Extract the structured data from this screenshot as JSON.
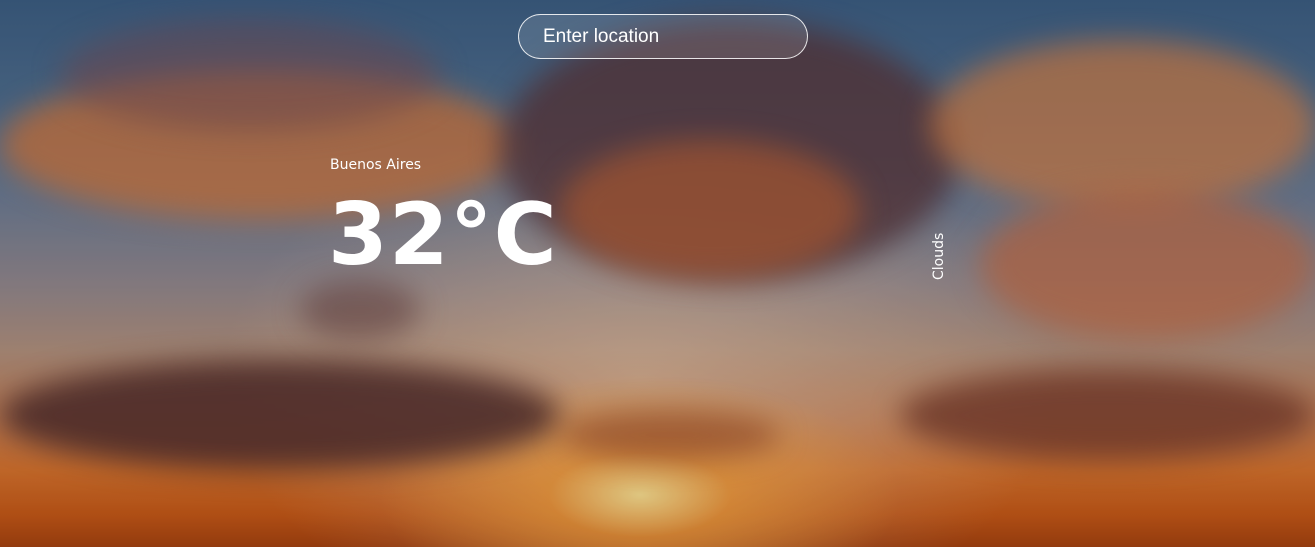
{
  "search": {
    "placeholder": "Enter location",
    "value": ""
  },
  "weather": {
    "location": "Buenos Aires",
    "temperature": "32°C",
    "condition": "Clouds"
  },
  "colors": {
    "text": "#ffffff",
    "sky_top": "#3d5f85",
    "horizon": "#d9742e"
  }
}
